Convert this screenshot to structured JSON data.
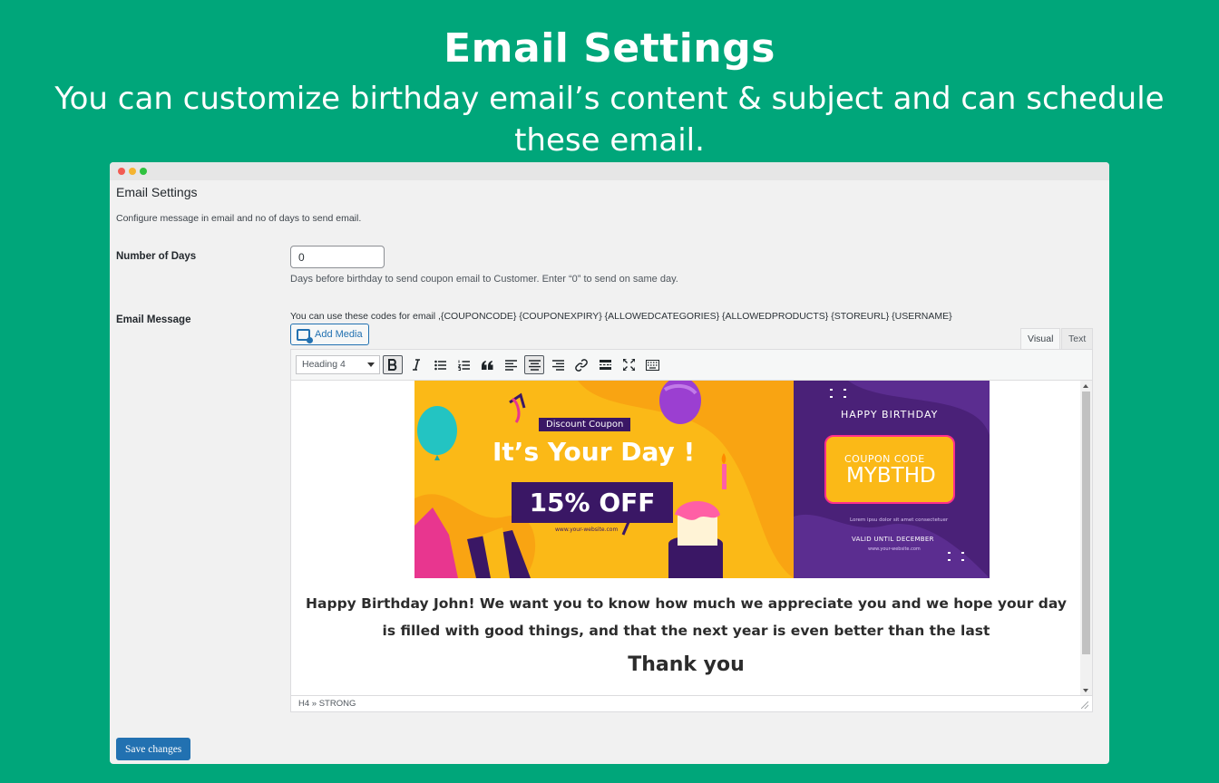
{
  "hero": {
    "title": "Email Settings",
    "subtitle": "You can customize birthday email’s content & subject and can schedule these email."
  },
  "window": {
    "title": "Email Settings",
    "description": "Configure message in email and no of days to send email."
  },
  "days": {
    "label": "Number of Days",
    "value": "0",
    "help": "Days before birthday to send coupon email to Customer. Enter “0” to send on same day."
  },
  "email": {
    "label": "Email Message",
    "codes_hint": "You can use these codes for email ,{COUPONCODE} {COUPONEXPIRY} {ALLOWEDCATEGORIES} {ALLOWEDPRODUCTS} {STOREURL} {USERNAME}",
    "add_media": "Add Media",
    "tabs": {
      "visual": "Visual",
      "text": "Text"
    },
    "format_select": "Heading 4",
    "toolbar_icons": [
      "bold-icon",
      "italic-icon",
      "bullet-list-icon",
      "numbered-list-icon",
      "blockquote-icon",
      "align-left-icon",
      "align-center-icon",
      "align-right-icon",
      "link-icon",
      "read-more-icon",
      "fullscreen-icon",
      "toolbar-toggle-icon"
    ],
    "banner": {
      "tag": "Discount Coupon",
      "headline": "It’s Your Day !",
      "offer": "15% OFF",
      "site_left": "www.your-website.com",
      "greeting": "HAPPY BIRTHDAY",
      "coupon_label": "COUPON CODE",
      "coupon_code": "MYBTHD",
      "lorem": "Lorem ipsu dolor sit amet consectetuer",
      "valid": "VALID UNTIL DECEMBER",
      "site_right": "www.your-website.com"
    },
    "message": "Happy Birthday John! We want you to know how much we appreciate you and we hope your day is filled with good things, and that the next year is even better than the last",
    "thanks": "Thank you",
    "status_path": "H4 » STRONG"
  },
  "save_label": "Save changes",
  "colors": {
    "background": "#00a67a",
    "primary": "#2271b1",
    "banner_yellow": "#fbb917",
    "banner_purple": "#4a2178"
  }
}
